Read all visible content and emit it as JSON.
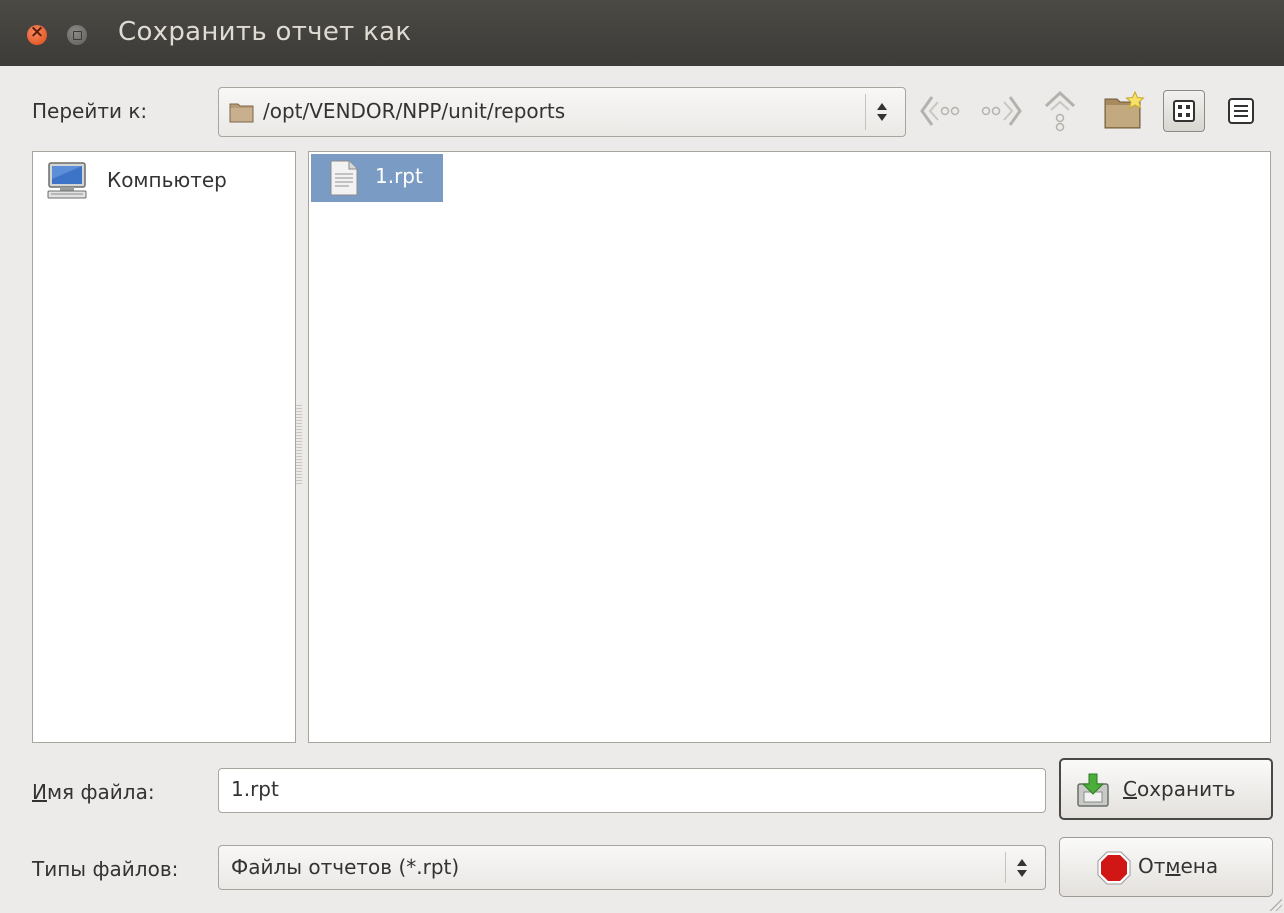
{
  "window": {
    "title": "Сохранить отчет как"
  },
  "location": {
    "label": "Перейти к:",
    "path": "/opt/VENDOR/NPP/unit/reports"
  },
  "toolbar": {
    "icons": [
      "back-icon",
      "forward-icon",
      "up-icon",
      "new-folder-icon",
      "icon-view-icon",
      "list-view-icon"
    ]
  },
  "places": [
    {
      "label": "Компьютер",
      "icon": "computer-icon"
    }
  ],
  "files": [
    {
      "name": "1.rpt",
      "icon": "document-icon",
      "selected": true
    }
  ],
  "filename": {
    "label_prefix": "И",
    "label_rest": "мя файла:",
    "value": "1.rpt"
  },
  "filetype": {
    "label": "Типы файлов:",
    "selected": "Файлы отчетов (*.rpt)"
  },
  "buttons": {
    "save_prefix": "С",
    "save_rest": "охранить",
    "cancel_before": "От",
    "cancel_mnemonic": "м",
    "cancel_after": "ена"
  },
  "colors": {
    "titlebar": "#3c3b37",
    "selection": "#7a9cc4",
    "background": "#edebe9"
  }
}
